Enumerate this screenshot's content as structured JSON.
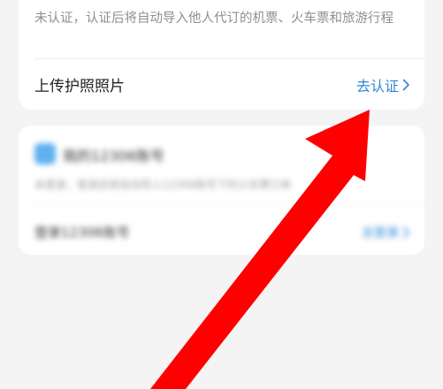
{
  "passport_card": {
    "description": "未认证，认证后将自动导入他人代订的机票、火车票和旅游行程",
    "row_label": "上传护照照片",
    "action_label": "去认证"
  },
  "account_card": {
    "title": "我的12306账号",
    "description": "未登录，登录后将自动导入12306账号下的火车票订单",
    "row_label": "登录12306账号",
    "action_label": "去登录"
  },
  "colors": {
    "link": "#2f86d6",
    "annotation": "#ff0000",
    "background": "#f4f4f4"
  },
  "icons": {
    "chevron": "chevron-right-icon",
    "app_icon": "app-square-icon",
    "annotation": "red-arrow-icon"
  }
}
